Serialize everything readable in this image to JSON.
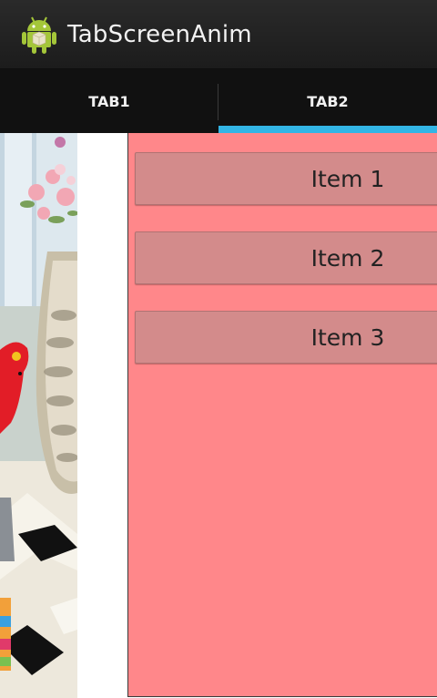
{
  "action_bar": {
    "title": "TabScreenAnim",
    "icon": "android-robot-icon"
  },
  "tabs": [
    {
      "label": "TAB1",
      "selected": false
    },
    {
      "label": "TAB2",
      "selected": true
    }
  ],
  "items": [
    {
      "label": "Item 1"
    },
    {
      "label": "Item 2"
    },
    {
      "label": "Item 3"
    }
  ],
  "colors": {
    "accent": "#33b5e5",
    "panel_background": "#ff878a",
    "button_background": "#d38b8b"
  }
}
